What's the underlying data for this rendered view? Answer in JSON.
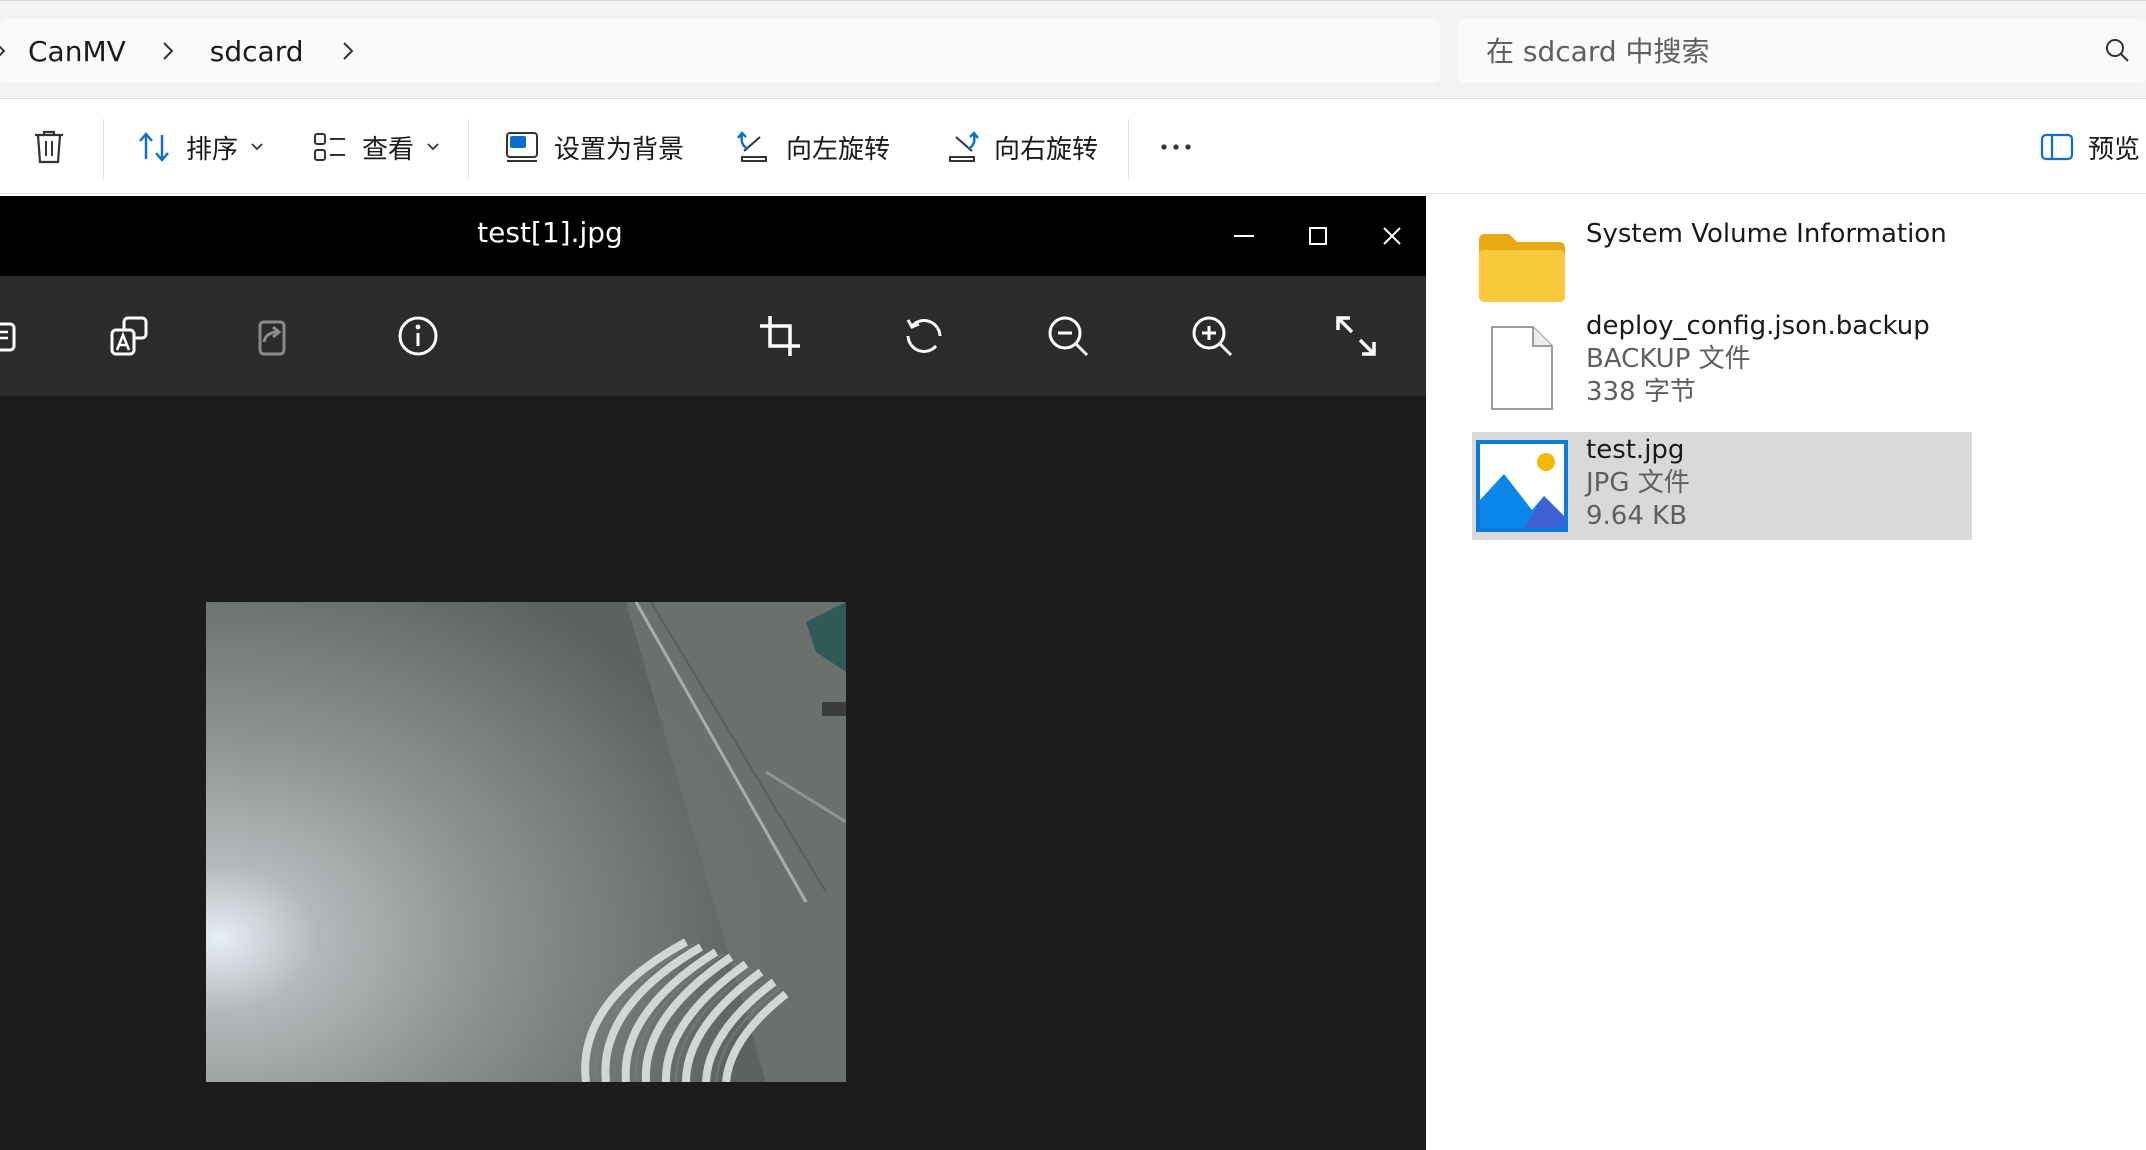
{
  "breadcrumb": {
    "items": [
      "CanMV",
      "sdcard"
    ]
  },
  "search": {
    "placeholder": "在 sdcard 中搜索"
  },
  "commandbar": {
    "sort_label": "排序",
    "view_label": "查看",
    "set_background_label": "设置为背景",
    "rotate_left_label": "向左旋转",
    "rotate_right_label": "向右旋转",
    "preview_label": "预览"
  },
  "viewer": {
    "title": "test[1].jpg"
  },
  "files": [
    {
      "name": "System Volume Information",
      "type": "",
      "size": "",
      "icon": "folder-icon"
    },
    {
      "name": "deploy_config.json.backup",
      "type": "BACKUP 文件",
      "size": "338 字节",
      "icon": "generic-file-icon"
    },
    {
      "name": "test.jpg",
      "type": "JPG 文件",
      "size": "9.64 KB",
      "icon": "image-file-icon",
      "selected": true
    }
  ],
  "colors": {
    "accent_blue": "#0a6ed1",
    "folder_yellow": "#f8c93c",
    "selection_gray": "#d9d9d9",
    "viewer_bg": "#1c1c1c"
  }
}
